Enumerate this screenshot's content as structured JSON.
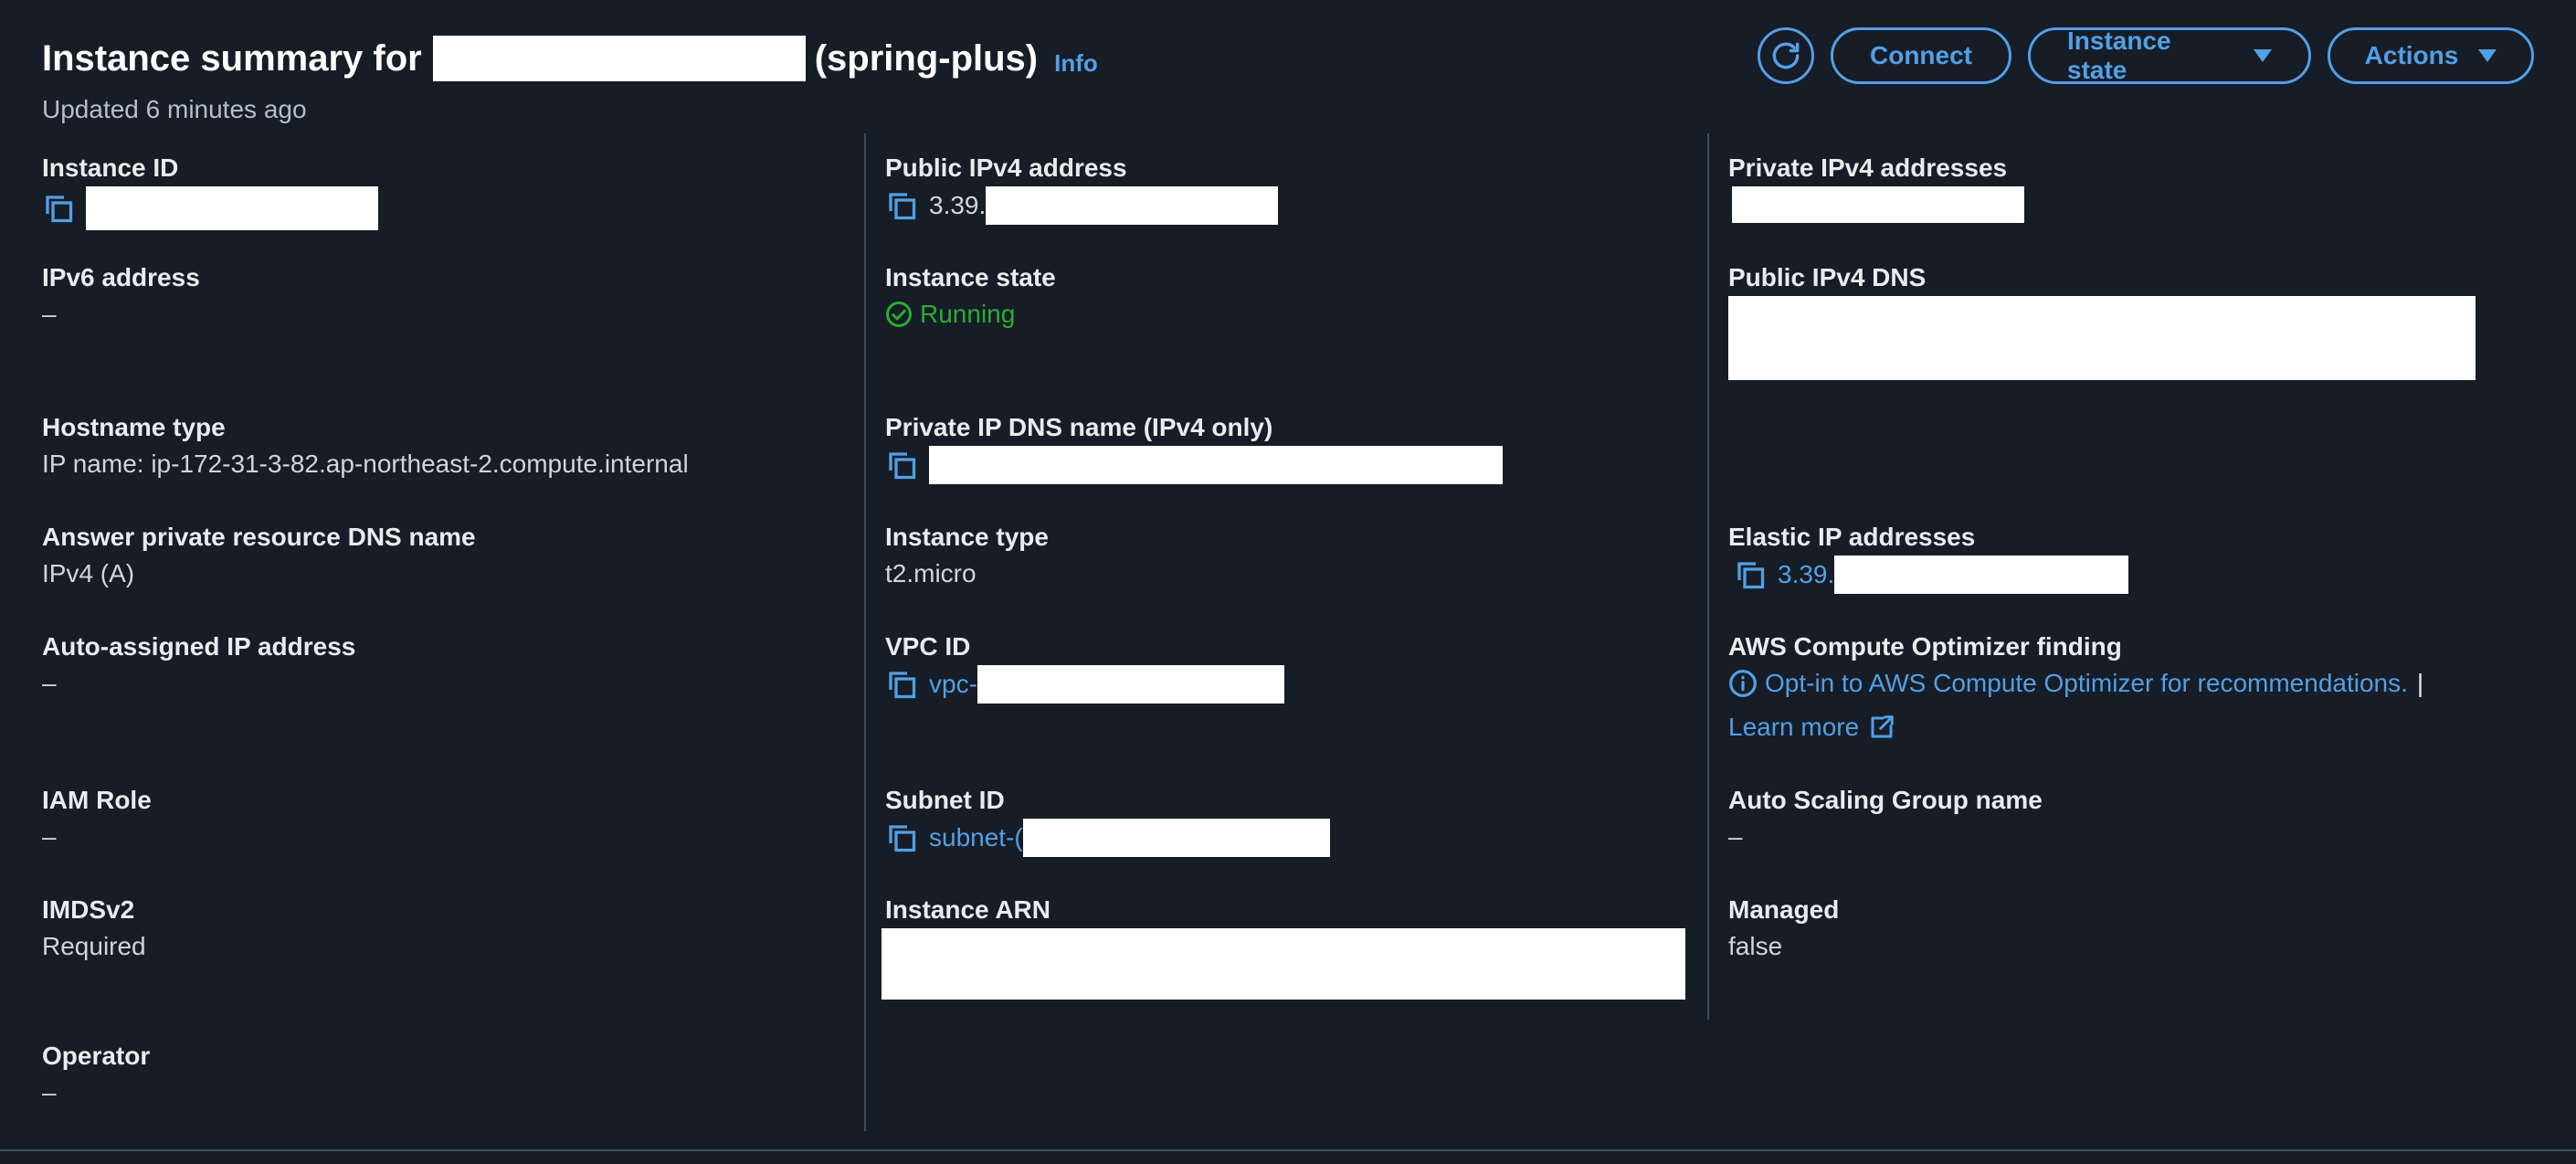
{
  "header": {
    "title_prefix": "Instance summary for",
    "title_suffix": "(spring-plus)",
    "info_link": "Info",
    "updated": "Updated 6 minutes ago",
    "buttons": {
      "refresh_icon": "refresh-icon",
      "connect": "Connect",
      "instance_state": "Instance state",
      "actions": "Actions"
    }
  },
  "colors": {
    "background": "#161d26",
    "link": "#539fe5",
    "running": "#29ad32",
    "label": "#e9ebed",
    "divider": "#414d5c"
  },
  "fields": {
    "instance_id": {
      "label": "Instance ID",
      "icon": "copy-icon"
    },
    "ipv6_address": {
      "label": "IPv6 address",
      "value": "–"
    },
    "hostname_type": {
      "label": "Hostname type",
      "value": "IP name: ip-172-31-3-82.ap-northeast-2.compute.internal"
    },
    "answer_private_dns": {
      "label": "Answer private resource DNS name",
      "value": "IPv4 (A)"
    },
    "auto_assigned_ip": {
      "label": "Auto-assigned IP address",
      "value": "–"
    },
    "iam_role": {
      "label": "IAM Role",
      "value": "–"
    },
    "imdsv2": {
      "label": "IMDSv2",
      "value": "Required"
    },
    "operator": {
      "label": "Operator",
      "value": "–"
    },
    "public_ipv4": {
      "label": "Public IPv4 address",
      "value": "3.39.",
      "icon": "copy-icon"
    },
    "instance_state": {
      "label": "Instance state",
      "value": "Running",
      "icon": "check-circle-icon"
    },
    "private_ip_dns": {
      "label": "Private IP DNS name (IPv4 only)",
      "icon": "copy-icon"
    },
    "instance_type": {
      "label": "Instance type",
      "value": "t2.micro"
    },
    "vpc_id": {
      "label": "VPC ID",
      "value": "vpc-",
      "icon": "copy-icon"
    },
    "subnet_id": {
      "label": "Subnet ID",
      "value": "subnet-(",
      "icon": "copy-icon"
    },
    "instance_arn": {
      "label": "Instance ARN"
    },
    "private_ipv4": {
      "label": "Private IPv4 addresses"
    },
    "public_ipv4_dns": {
      "label": "Public IPv4 DNS"
    },
    "elastic_ip": {
      "label": "Elastic IP addresses",
      "value": "3.39.",
      "icon": "copy-icon"
    },
    "compute_optimizer": {
      "label": "AWS Compute Optimizer finding",
      "link": "Opt-in to AWS Compute Optimizer for recommendations.",
      "separator": "|",
      "learn_more": "Learn more",
      "info_icon": "info-circle-icon",
      "external_icon": "external-link-icon"
    },
    "auto_scaling_group": {
      "label": "Auto Scaling Group name",
      "value": "–"
    },
    "managed": {
      "label": "Managed",
      "value": "false"
    }
  }
}
